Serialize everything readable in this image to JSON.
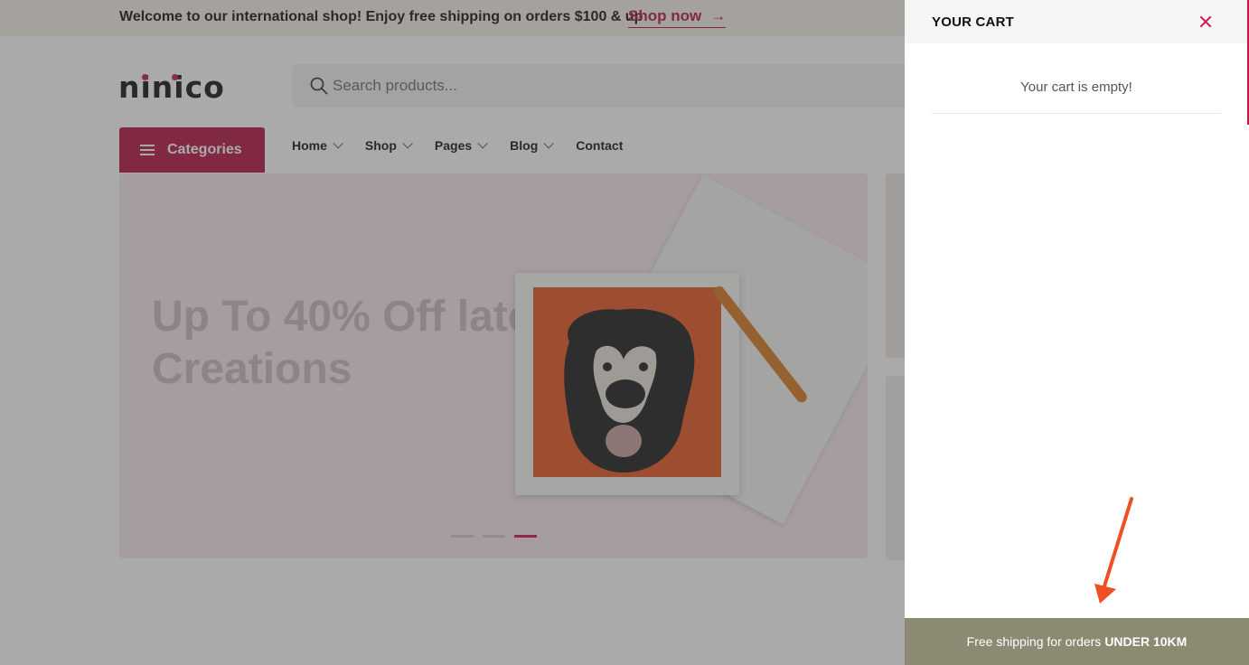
{
  "topbar": {
    "message": "Welcome to our international shop! Enjoy free shipping on orders $100 & up",
    "link_label": "Shop now",
    "link_arrow": "→"
  },
  "header": {
    "logo_text": "ninico",
    "search": {
      "placeholder": "Search products..."
    }
  },
  "nav": {
    "categories_label": "Categories",
    "items": [
      {
        "label": "Home",
        "has_dropdown": true
      },
      {
        "label": "Shop",
        "has_dropdown": true
      },
      {
        "label": "Pages",
        "has_dropdown": true
      },
      {
        "label": "Blog",
        "has_dropdown": true
      },
      {
        "label": "Contact",
        "has_dropdown": false
      }
    ]
  },
  "hero": {
    "subtitle": "",
    "title": "Up To 40% Off latest Creations",
    "slider_total": 3,
    "slider_active_index": 2
  },
  "cart": {
    "title": "YOUR CART",
    "empty_message": "Your cart is empty!",
    "shipping_prefix": "Free shipping for orders",
    "shipping_bold": "UNDER 10KM"
  },
  "colors": {
    "brand": "#b3123f",
    "shipping_bar": "#8c8a72",
    "annotation_arrow": "#f04e23"
  }
}
